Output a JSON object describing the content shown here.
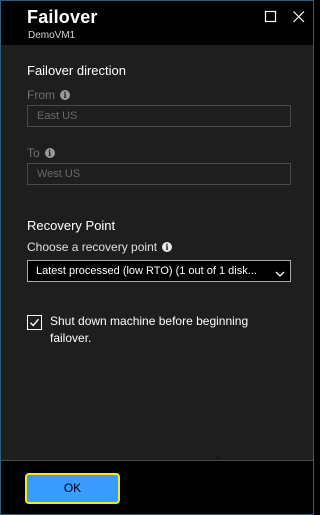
{
  "header": {
    "title": "Failover",
    "subtitle": "DemoVM1",
    "maximize_icon": "maximize-icon",
    "close_icon": "close-icon"
  },
  "failover_direction": {
    "heading": "Failover direction",
    "from_label": "From",
    "from_value": "East US",
    "to_label": "To",
    "to_value": "West US"
  },
  "recovery_point": {
    "heading": "Recovery Point",
    "choose_label": "Choose a recovery point",
    "selected_value": "Latest processed (low RTO) (1 out of 1 disk..."
  },
  "shutdown": {
    "checked": true,
    "label": "Shut down machine before beginning failover."
  },
  "footer": {
    "ok_label": "OK"
  },
  "colors": {
    "accent": "#3b9cff",
    "focus_border": "#f7ea16",
    "panel_bg": "#1e1e1e",
    "header_bg": "#000000"
  }
}
